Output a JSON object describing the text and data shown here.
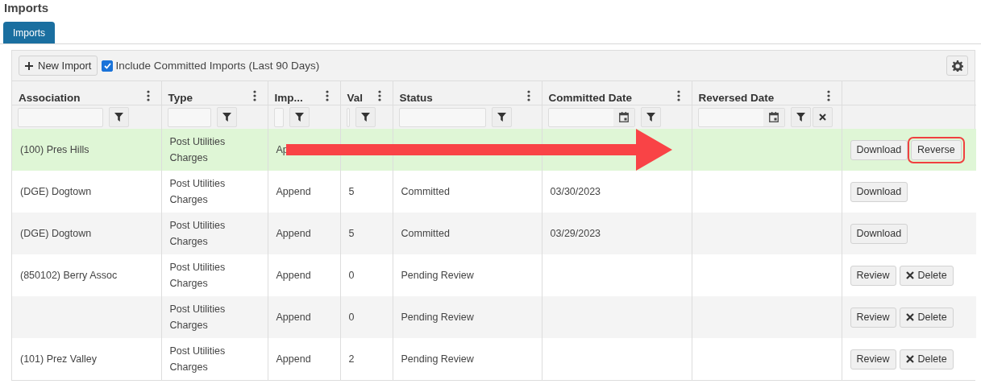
{
  "page_title": "Imports",
  "tabs": [
    {
      "label": "Imports",
      "selected": true
    }
  ],
  "toolbar": {
    "new_button": "New Import",
    "include_committed": {
      "label": "Include Committed Imports (Last 90 Days)",
      "checked": true
    }
  },
  "table": {
    "columns": [
      {
        "title": "Association",
        "kind": "text"
      },
      {
        "title": "Type",
        "kind": "text"
      },
      {
        "title": "Imp...",
        "kind": "text"
      },
      {
        "title": "Val",
        "kind": "text"
      },
      {
        "title": "Status",
        "kind": "text"
      },
      {
        "title": "Committed Date",
        "kind": "date"
      },
      {
        "title": "Reversed Date",
        "kind": "date",
        "clear": true
      },
      {}
    ],
    "rows": [
      {
        "selected": true,
        "cells": [
          "(100) Pres Hills",
          "Post Utilities Charges",
          "Ap",
          "",
          "",
          "",
          ""
        ],
        "actions": [
          {
            "label": "Download",
            "kind": "plain",
            "highlighted": false
          },
          {
            "label": "Reverse",
            "kind": "plain",
            "highlighted": true
          }
        ]
      },
      {
        "selected": false,
        "cells": [
          "(DGE) Dogtown",
          "Post Utilities Charges",
          "Append",
          "5",
          "Committed",
          "03/30/2023",
          ""
        ],
        "actions": [
          {
            "label": "Download",
            "kind": "plain",
            "highlighted": false
          }
        ]
      },
      {
        "selected": false,
        "cells": [
          "(DGE) Dogtown",
          "Post Utilities Charges",
          "Append",
          "5",
          "Committed",
          "03/29/2023",
          ""
        ],
        "actions": [
          {
            "label": "Download",
            "kind": "plain",
            "highlighted": false
          }
        ]
      },
      {
        "selected": false,
        "cells": [
          "(850102) Berry Assoc",
          "Post Utilities Charges",
          "Append",
          "0",
          "Pending Review",
          "",
          ""
        ],
        "actions": [
          {
            "label": "Review",
            "kind": "plain",
            "highlighted": false
          },
          {
            "label": "Delete",
            "kind": "delete",
            "highlighted": false
          }
        ]
      },
      {
        "selected": false,
        "cells": [
          "",
          "Post Utilities Charges",
          "Append",
          "0",
          "Pending Review",
          "",
          ""
        ],
        "actions": [
          {
            "label": "Review",
            "kind": "plain",
            "highlighted": false
          },
          {
            "label": "Delete",
            "kind": "delete",
            "highlighted": false
          }
        ]
      },
      {
        "selected": false,
        "cells": [
          "(101) Prez Valley",
          "Post Utilities Charges",
          "Append",
          "2",
          "Pending Review",
          "",
          ""
        ],
        "actions": [
          {
            "label": "Review",
            "kind": "plain",
            "highlighted": false
          },
          {
            "label": "Delete",
            "kind": "delete",
            "highlighted": false
          }
        ]
      }
    ]
  },
  "annotations": [
    {
      "kind": "arrow"
    }
  ]
}
